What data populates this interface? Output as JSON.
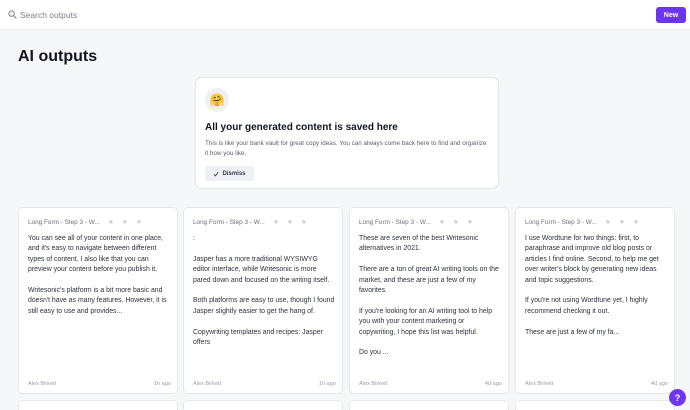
{
  "header": {
    "search_placeholder": "Search outputs",
    "new_label": "New"
  },
  "page": {
    "title": "AI outputs"
  },
  "info_card": {
    "icon": "🤗",
    "title": "All your generated content is saved here",
    "description": "This is like your bank vault for great copy ideas. You can always come back here to find and organize it how you like.",
    "dismiss_label": "Dismiss"
  },
  "cards": [
    {
      "tag": "Long Form - Step 3 - W...",
      "paragraphs": [
        "You can see all of your content in one place, and it's easy to navigate between different types of content. I also like that you can preview your content before you publish it.",
        "Writesonic's platform is a bit more basic and doesn't have as many features. However, it is still easy to use and provides..."
      ],
      "author": "Alex Birkett",
      "time": "1h ago"
    },
    {
      "tag": "Long Form - Step 3 - W...",
      "paragraphs": [
        ":",
        "Jasper has a more traditional WYSIWYG editor interface, while Writesonic is more pared down and focused on the writing itself.",
        "Both platforms are easy to use, though I found Jasper slightly easier to get the hang of.",
        "Copywriting templates and recipes: Jasper offers"
      ],
      "author": "Alex Birkett",
      "time": "1h ago"
    },
    {
      "tag": "Long Form - Step 3 - W...",
      "paragraphs": [
        "These are seven of the best Writesonic alternatives in 2021.",
        "There are a ton of great AI writing tools on the market, and these are just a few of my favorites.",
        "If you're looking for an AI writing tool to help you with your content marketing or copywriting, I hope this list was helpful.",
        "Do you ..."
      ],
      "author": "Alex Birkett",
      "time": "4d ago"
    },
    {
      "tag": "Long Form - Step 3 - W...",
      "paragraphs": [
        "I use Wordtune for two things: first, to paraphrase and improve old blog posts or articles I find online. Second, to help me get over writer's block by generating new ideas and topic suggestions.",
        "If you're not using Wordtune yet, I highly recommend checking it out.",
        "These are just a few of my fa..."
      ],
      "author": "Alex Birkett",
      "time": "4d ago"
    }
  ],
  "help_label": "?",
  "colors": {
    "accent": "#6d35f0",
    "background": "#f6f7f9",
    "card": "#ffffff"
  }
}
